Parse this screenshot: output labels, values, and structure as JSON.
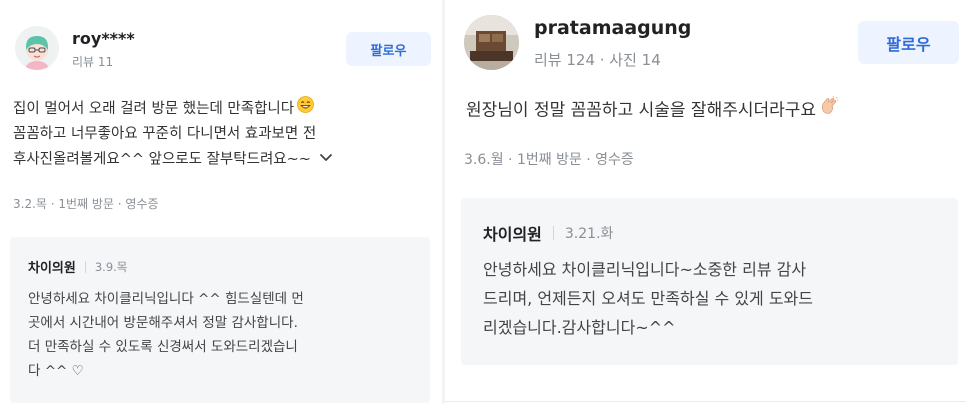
{
  "left_review": {
    "author": "roy****",
    "author_meta": "리뷰 11",
    "follow_label": "팔로우",
    "text_lines": [
      "집이 멀어서 오래 걸려 방문 했는데 만족합니다",
      "꼼꼼하고 너무좋아요 꾸준히 다니면서 효과보면 전",
      "후사진올려볼게요^^ 앞으로도 잘부탁드려요~~"
    ],
    "visit_info": "3.2.목 · 1번째 방문 · 영수증",
    "reply": {
      "author": "차이의원",
      "date": "3.9.목",
      "text_lines": [
        "안녕하세요 차이클리닉입니다 ^^ 힘드실텐데 먼",
        "곳에서 시간내어 방문해주셔서 정말 감사합니다.",
        "더 만족하실 수 있도록 신경써서 도와드리겠습니",
        "다 ^^ ♡"
      ]
    }
  },
  "right_review": {
    "author": "pratamaagung",
    "author_meta": "리뷰 124 · 사진 14",
    "follow_label": "팔로우",
    "text_lines": [
      "원장님이 정말 꼼꼼하고 시술을 잘해주시더라구요"
    ],
    "visit_info": "3.6.월 · 1번째 방문 · 영수증",
    "reply": {
      "author": "차이의원",
      "date": "3.21.화",
      "text_lines": [
        "안녕하세요 차이클리닉입니다~소중한 리뷰 감사",
        "드리며, 언제든지 오셔도 만족하실 수 있게 도와드",
        "리겠습니다.감사합니다~^^"
      ]
    }
  },
  "colors": {
    "follow_bg": "#eef4ff",
    "follow_text": "#2e6bd8",
    "reply_bg": "#f4f6f8",
    "meta_text": "#8a8f96"
  },
  "icons": {
    "left_emoji": "smiling-face-emoji",
    "right_emoji": "clapping-hand-emoji",
    "expand": "chevron-down-icon"
  }
}
